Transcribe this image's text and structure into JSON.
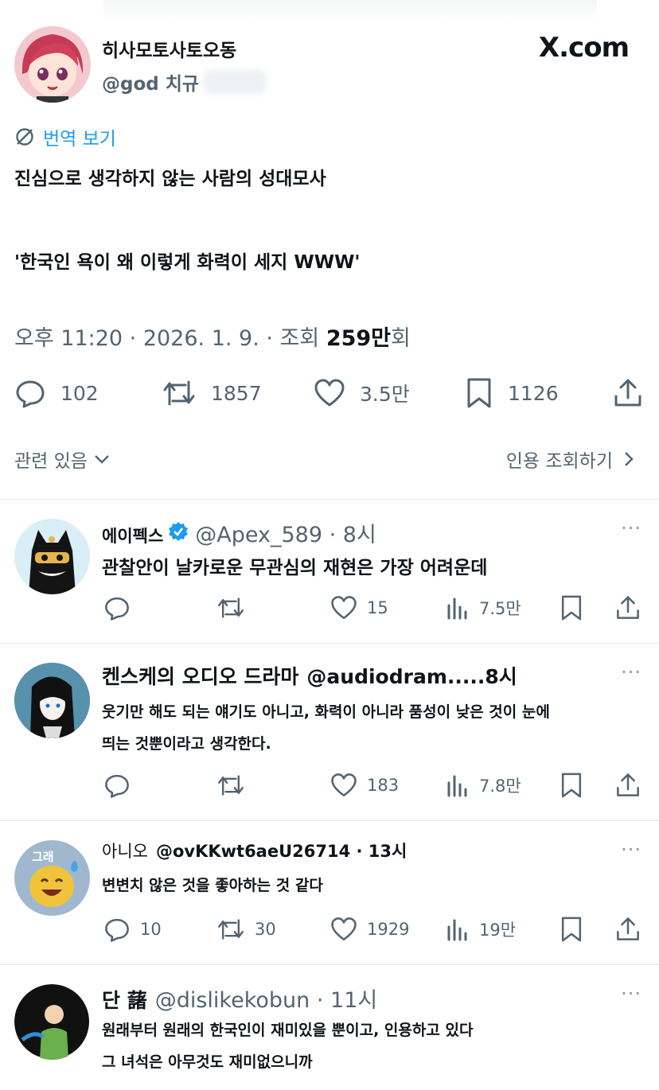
{
  "header_brand": "X.com",
  "main_tweet": {
    "author_name": "히사모토사토오동",
    "author_handle": "@god 치규",
    "translate_label": "번역 보기",
    "text_line1": "진심으로 생각하지 않는 사람의 성대모사",
    "text_line2": "'한국인 욕이 왜 이렇게 화력이 세지 WWW'",
    "meta_prefix": "오후 11:20 · 2026. 1. 9. · 조회 ",
    "views_value": "259만",
    "views_suffix": "회",
    "replies": "102",
    "reposts": "1857",
    "likes": "3.5만",
    "bookmarks": "1126",
    "related_label": "관련 있음",
    "quotes_label": "인용 조회하기"
  },
  "replies": [
    {
      "name": "에이펙스",
      "verified": true,
      "handle": "@Apex_589 · 8시",
      "lines": [
        "관찰안이 날카로운 무관심의 재현은 가장 어려운데"
      ],
      "replies": "",
      "reposts": "",
      "likes": "15",
      "views": "7.5만"
    },
    {
      "name": "켄스케의 오디오 드라마",
      "verified": false,
      "handle": "@audiodram.....8시",
      "lines": [
        "웃기만 해도 되는 얘기도 아니고, 화력이 아니라 품성이 낮은 것이 눈에",
        "띄는 것뿐이라고 생각한다."
      ],
      "replies": "",
      "reposts": "",
      "likes": "183",
      "views": "7.8만"
    },
    {
      "name": "아니오",
      "verified": false,
      "handle": "@ovKKwt6aeU26714 · 13시",
      "lines": [
        "변변치 않은 것을 좋아하는 것 같다"
      ],
      "replies": "10",
      "reposts": "30",
      "likes": "1929",
      "views": "19만"
    },
    {
      "name": "단 藷",
      "verified": false,
      "handle": "@dislikekobun · 11시",
      "lines": [
        "원래부터 원래의 한국인이 재미있을 뿐이고, 인용하고 있다",
        "그 녀석은 아무것도 재미없으니까"
      ]
    }
  ],
  "avatar3_text": "그래",
  "more_label": "···",
  "colors": {
    "text": "#0f1419",
    "muted": "#536471",
    "link": "#1d9bf0",
    "verified": "#1d9bf0",
    "divider": "#e6e9ec"
  },
  "icons": [
    "reply-icon",
    "repost-icon",
    "like-icon",
    "bookmark-icon",
    "share-icon",
    "views-icon",
    "translate-icon",
    "verified-badge-icon",
    "more-icon",
    "chevron-down-icon",
    "chevron-right-icon"
  ]
}
